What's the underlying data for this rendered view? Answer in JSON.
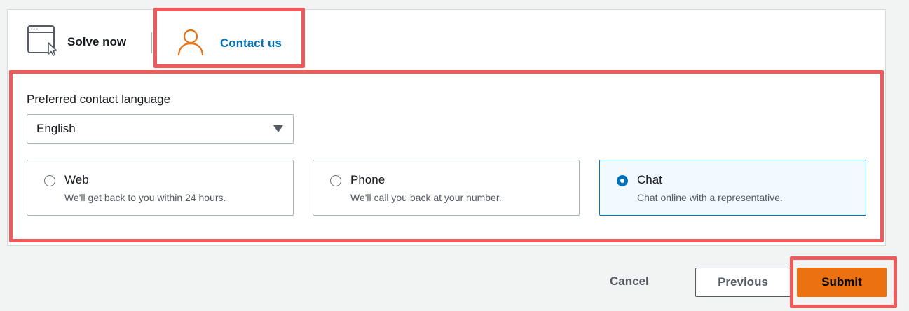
{
  "tabs": {
    "solve_now": {
      "label": "Solve now",
      "icon": "window-cursor-icon"
    },
    "contact_us": {
      "label": "Contact us",
      "icon": "user-icon",
      "selected": true
    }
  },
  "form": {
    "language_label": "Preferred contact language",
    "language_value": "English",
    "options": [
      {
        "title": "Web",
        "description": "We'll get back to you within 24 hours.",
        "selected": false
      },
      {
        "title": "Phone",
        "description": "We'll call you back at your number.",
        "selected": false
      },
      {
        "title": "Chat",
        "description": "Chat online with a representative.",
        "selected": true
      }
    ]
  },
  "footer": {
    "cancel_label": "Cancel",
    "previous_label": "Previous",
    "submit_label": "Submit"
  },
  "colors": {
    "accent": "#0073bb",
    "submit": "#ec7211",
    "highlight": "#ef5b5b",
    "contact_icon": "#ec7211"
  }
}
